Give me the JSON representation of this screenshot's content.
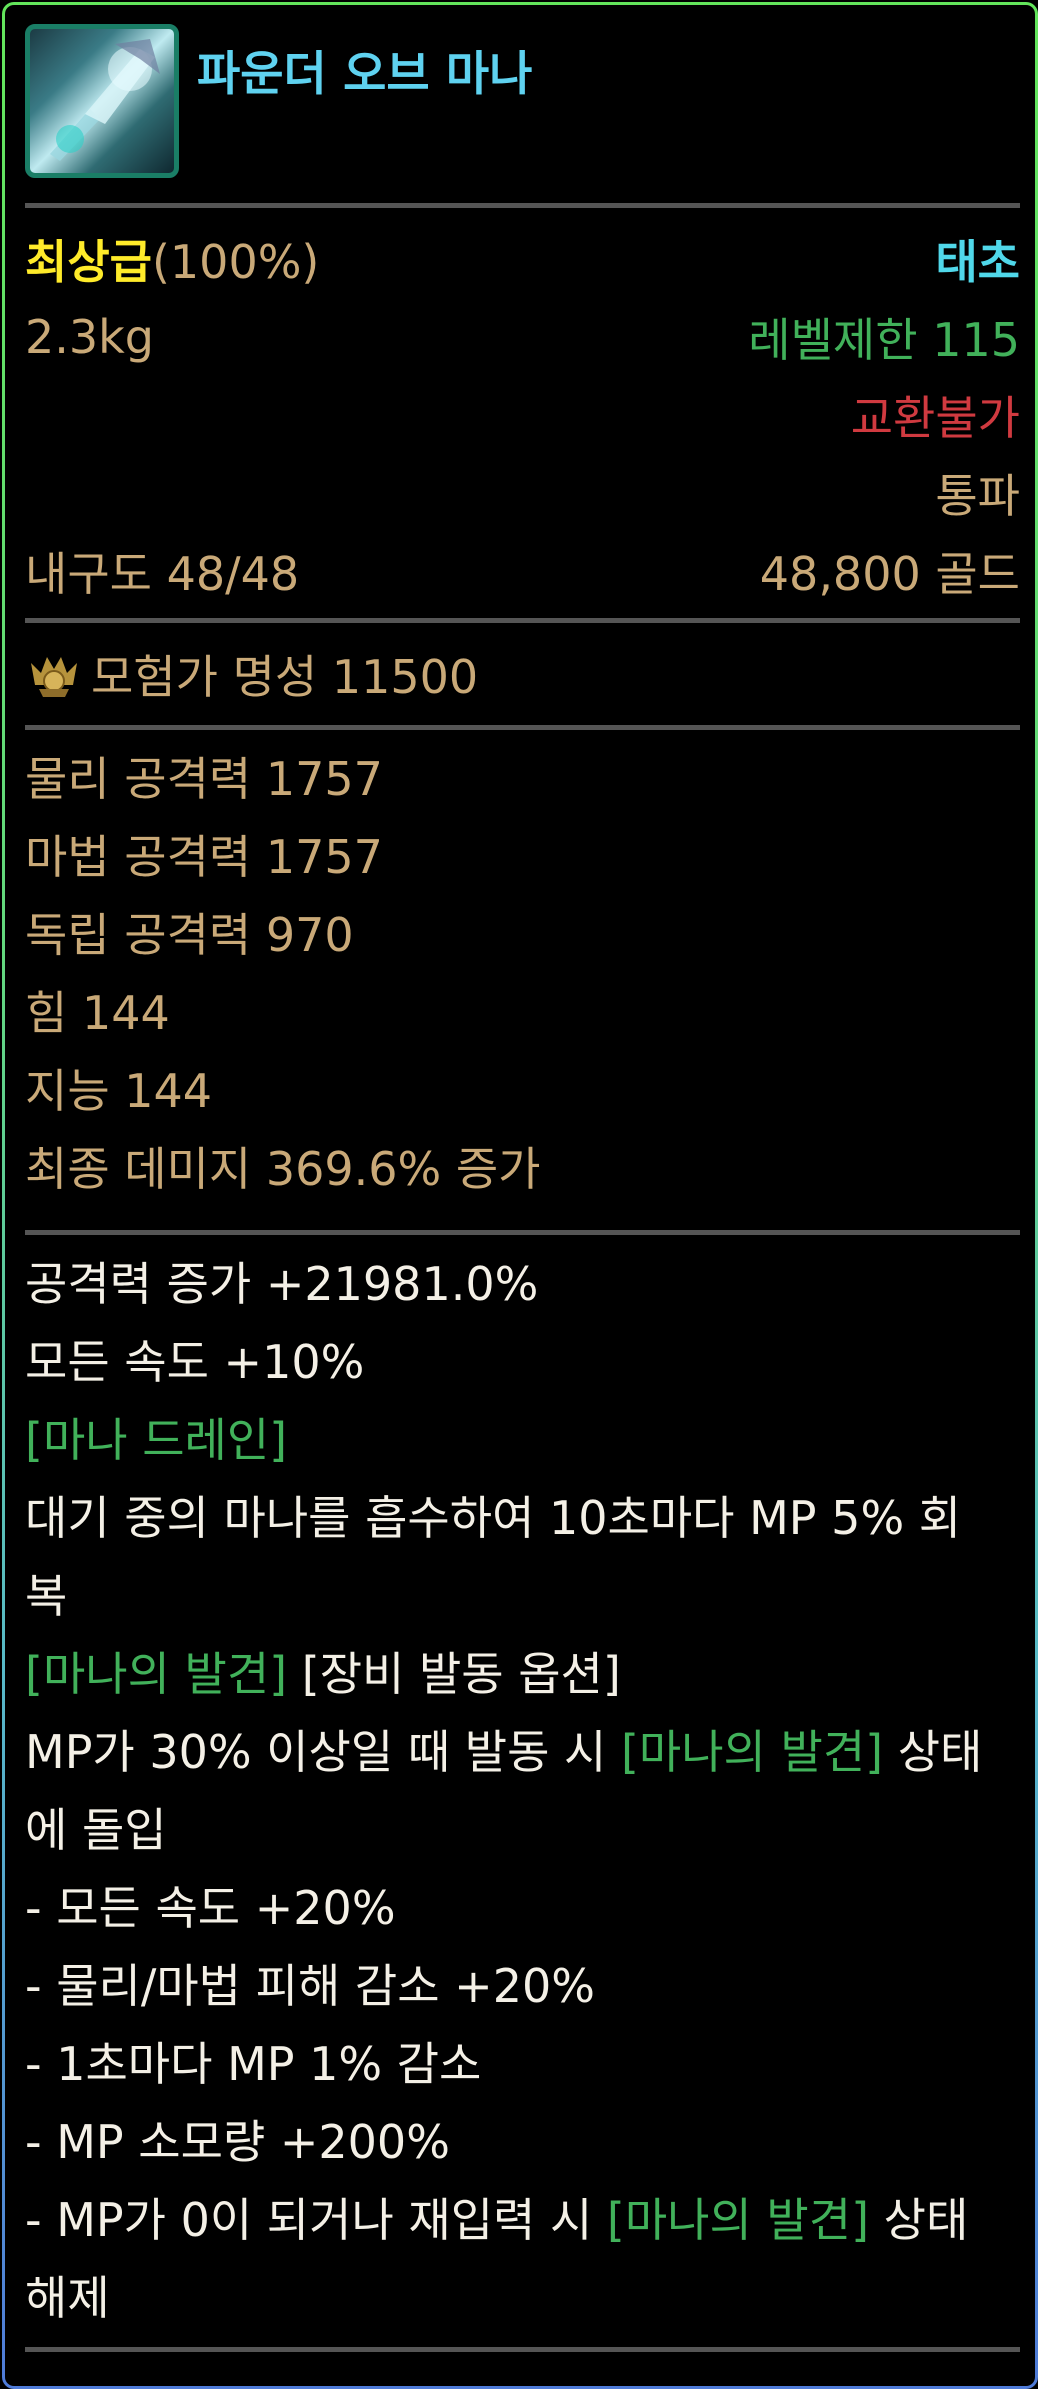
{
  "item": {
    "name": "파운더 오브 마나",
    "icon": "magic-orb-weapon-icon"
  },
  "info": {
    "grade": "최상급",
    "grade_pct": "(100%)",
    "rarity": "태초",
    "weight": "2.3kg",
    "level_limit": "레벨제한 115",
    "trade": "교환불가",
    "seal": "통파",
    "durability": "내구도 48/48",
    "price": "48,800 골드"
  },
  "fame": {
    "icon": "crown-fame-icon",
    "text": "모험가 명성 11500"
  },
  "stats": [
    "물리 공격력 1757",
    "마법 공격력 1757",
    "독립 공격력 970",
    "힘 144",
    "지능 144",
    "최종 데미지 369.6% 증가"
  ],
  "options": {
    "atk_inc": "공격력 증가 +21981.0%",
    "all_speed": "모든 속도 +10%",
    "drain_tag": "[마나 드레인]",
    "drain_desc_1": "대기 중의 마나를 흡수하여 10초마다 MP 5% 회",
    "drain_desc_2": "복",
    "discovery_tag": "[마나의 발견]",
    "equip_tag": " [장비 발동 옵션]",
    "cond_pre": "MP가 30% 이상일 때 발동 시 ",
    "cond_tag": "[마나의 발견]",
    "cond_post": " 상태",
    "cond_line2": "에 돌입",
    "eff1": "- 모든 속도 +20%",
    "eff2": "- 물리/마법 피해 감소 +20%",
    "eff3": "- 1초마다 MP 1% 감소",
    "eff4": "- MP 소모량 +200%",
    "end_pre": "- MP가 0이 되거나 재입력 시 ",
    "end_tag": "[마나의 발견]",
    "end_post": " 상태",
    "end_line2": "해제"
  },
  "colors": {
    "title": "#5fd2f0",
    "grade": "#ffeb2a",
    "rarity": "#50d8ea",
    "stat": "#c9a978",
    "green": "#41b15a",
    "red": "#d03a40",
    "border": "#63e55b"
  }
}
